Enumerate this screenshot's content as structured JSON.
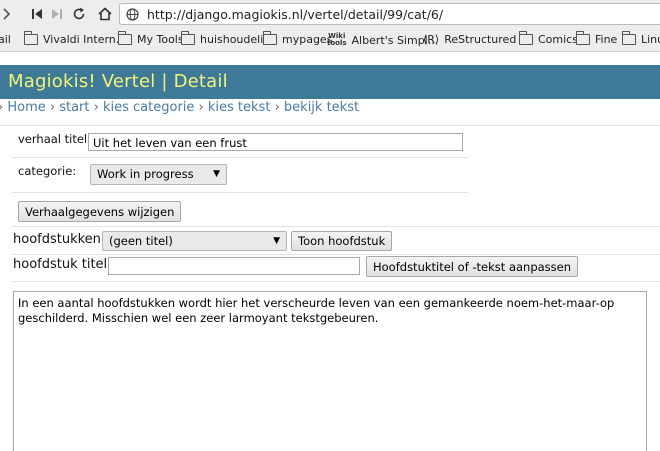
{
  "browser": {
    "url": "http://django.magiokis.nl/vertel/detail/99/cat/6/",
    "bookmarks": [
      {
        "label": "ail",
        "icon": "folder-icon"
      },
      {
        "label": "Vivaldi Intern...",
        "icon": "folder-icon"
      },
      {
        "label": "My Tools",
        "icon": "folder-icon"
      },
      {
        "label": "huishoudelijk",
        "icon": "folder-icon"
      },
      {
        "label": "mypages",
        "icon": "folder-icon"
      },
      {
        "label": "Albert's Simpl...",
        "icon": "wiki-icon"
      },
      {
        "label": "ReStructured ...",
        "icon": "restructured-icon"
      },
      {
        "label": "Comics",
        "icon": "folder-icon"
      },
      {
        "label": "Fine",
        "icon": "folder-icon"
      },
      {
        "label": "Linux",
        "icon": "folder-icon"
      }
    ]
  },
  "header": {
    "title": "Magiokis! Vertel | Detail",
    "bg_color": "#3c7a98",
    "title_color": "#f4f27a"
  },
  "breadcrumb": {
    "items": [
      "Home",
      "start",
      "kies categorie",
      "kies tekst",
      "bekijk tekst"
    ],
    "separator": "›"
  },
  "form": {
    "title_label": "verhaal titel:",
    "title_value": "Uit het leven van een frust",
    "category_label": "categorie:",
    "category_value": "Work in progress",
    "update_button": "Verhaalgegevens wijzigen"
  },
  "chapters": {
    "label": "hoofdstukken:",
    "select_value": "(geen titel)",
    "show_button": "Toon hoofdstuk",
    "title_label": "hoofdstuk titel:",
    "title_value": "",
    "update_button": "Hoofdstuktitel of -tekst aanpassen"
  },
  "text": {
    "content": "In een aantal hoofdstukken wordt hier het verscheurde leven van een gemankeerde noem-het-maar-op geschilderd. Misschien wel een zeer larmoyant tekstgebeuren."
  }
}
